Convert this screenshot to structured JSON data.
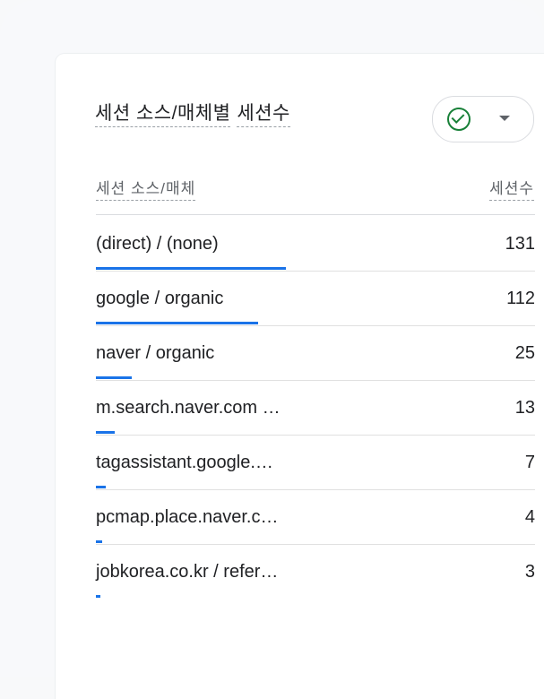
{
  "card": {
    "title_part1": "세션 소스/매체별",
    "title_part2": "세션수"
  },
  "controls": {
    "status_icon": "check-circle-icon",
    "menu_icon": "caret-down-icon",
    "accent_green": "#188038"
  },
  "table": {
    "column_dimension": "세션 소스/매체",
    "column_metric": "세션수",
    "bar_color": "#1a73e8",
    "max_value": 131,
    "rows": [
      {
        "label": "(direct) / (none)",
        "value": "131",
        "fraction": 1.0
      },
      {
        "label": "google / organic",
        "value": "112",
        "fraction": 0.855
      },
      {
        "label": "naver / organic",
        "value": "25",
        "fraction": 0.191
      },
      {
        "label": "m.search.naver.com …",
        "value": "13",
        "fraction": 0.099
      },
      {
        "label": "tagassistant.google.…",
        "value": "7",
        "fraction": 0.053
      },
      {
        "label": "pcmap.place.naver.c…",
        "value": "4",
        "fraction": 0.031
      },
      {
        "label": "jobkorea.co.kr / refer…",
        "value": "3",
        "fraction": 0.023
      }
    ]
  }
}
